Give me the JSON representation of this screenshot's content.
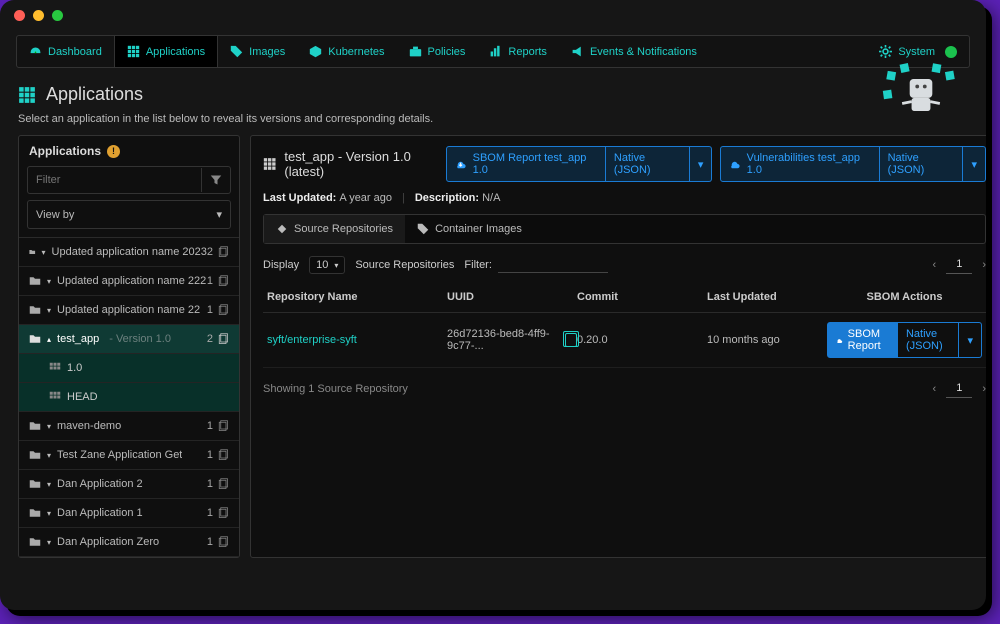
{
  "nav": {
    "dashboard": "Dashboard",
    "applications": "Applications",
    "images": "Images",
    "kubernetes": "Kubernetes",
    "policies": "Policies",
    "reports": "Reports",
    "events": "Events & Notifications",
    "system": "System"
  },
  "page": {
    "title": "Applications",
    "subtitle": "Select an application in the list below to reveal its versions and corresponding details."
  },
  "sidebar": {
    "heading": "Applications",
    "filter_placeholder": "Filter",
    "viewby": "View by",
    "items": [
      {
        "name": "Updated application name 2023",
        "count": "2"
      },
      {
        "name": "Updated application name 222",
        "count": "1"
      },
      {
        "name": "Updated application name 22",
        "count": "1"
      },
      {
        "name": "test_app",
        "version": "- Version 1.0",
        "count": "2",
        "selected": true,
        "expanded": true
      },
      {
        "name": "maven-demo",
        "count": "1"
      },
      {
        "name": "Test Zane Application Get",
        "count": "1"
      },
      {
        "name": "Dan Application 2",
        "count": "1"
      },
      {
        "name": "Dan Application 1",
        "count": "1"
      },
      {
        "name": "Dan Application Zero",
        "count": "1"
      }
    ],
    "children": [
      {
        "name": "1.0"
      },
      {
        "name": "HEAD"
      }
    ]
  },
  "main": {
    "title": "test_app - Version 1.0 (latest)",
    "sbom_btn": "SBOM Report test_app 1.0",
    "native": "Native (JSON)",
    "vuln_btn": "Vulnerabilities test_app 1.0",
    "last_updated_label": "Last Updated:",
    "last_updated_value": "A year ago",
    "desc_label": "Description:",
    "desc_value": "N/A",
    "tab_src": "Source Repositories",
    "tab_img": "Container Images",
    "display": "Display",
    "display_count": "10",
    "display_unit": "Source Repositories",
    "filter_label": "Filter:",
    "page_num": "1",
    "cols": {
      "repo": "Repository Name",
      "uuid": "UUID",
      "commit": "Commit",
      "updated": "Last Updated",
      "actions": "SBOM Actions"
    },
    "row": {
      "repo": "syft/enterprise-syft",
      "uuid": "26d72136-bed8-4ff9-9c77-...",
      "commit": "0.20.0",
      "updated": "10 months ago",
      "sbom": "SBOM Report",
      "native": "Native (JSON)"
    },
    "footer": "Showing 1 Source Repository"
  }
}
